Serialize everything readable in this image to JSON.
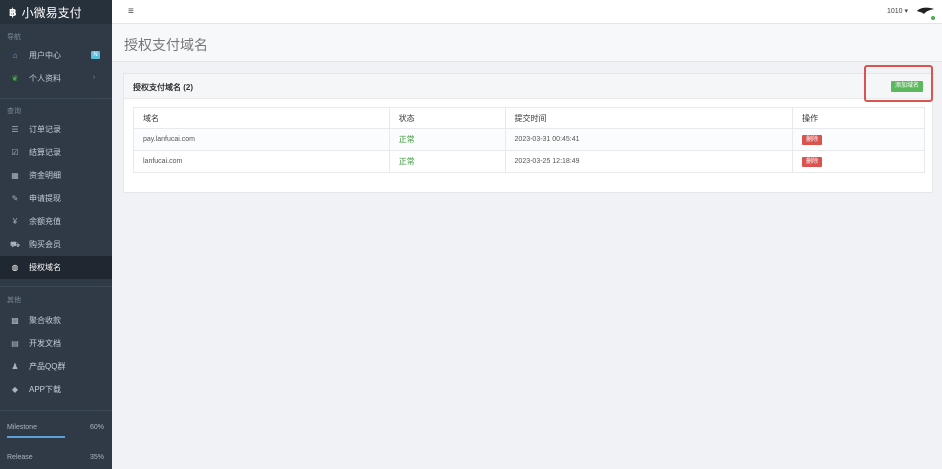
{
  "brand": {
    "logo": "฿",
    "name": "小微易支付"
  },
  "sidebar": {
    "sections": [
      {
        "label": "导航",
        "items": [
          {
            "label": "用户中心",
            "icon": "home-icon",
            "badge": "N"
          },
          {
            "label": "个人资料",
            "icon": "leaf-icon",
            "chevron": "›"
          }
        ]
      },
      {
        "label": "查询",
        "items": [
          {
            "label": "订单记录",
            "icon": "list-icon"
          },
          {
            "label": "结算记录",
            "icon": "checkbox-icon"
          },
          {
            "label": "资金明细",
            "icon": "calendar-icon"
          },
          {
            "label": "申请提现",
            "icon": "edit-icon"
          },
          {
            "label": "余额充值",
            "icon": "yen-icon"
          },
          {
            "label": "购买会员",
            "icon": "cart-icon"
          },
          {
            "label": "授权域名",
            "icon": "globe-icon",
            "active": true
          }
        ]
      },
      {
        "label": "其他",
        "items": [
          {
            "label": "聚合收款",
            "icon": "qrcode-icon"
          },
          {
            "label": "开发文档",
            "icon": "book-icon"
          },
          {
            "label": "产品QQ群",
            "icon": "qq-icon"
          },
          {
            "label": "APP下载",
            "icon": "android-icon"
          }
        ]
      }
    ],
    "progress": [
      {
        "label": "Milestone",
        "percent": "60%",
        "value": 0.6
      },
      {
        "label": "Release",
        "percent": "35%",
        "value": 0.35
      }
    ]
  },
  "topbar": {
    "toggle_icon": "≡",
    "user": "1010 ▾"
  },
  "page": {
    "title": "授权支付域名"
  },
  "panel": {
    "title": "授权支付域名 (2)",
    "add_button": "添加域名",
    "columns": [
      "域名",
      "状态",
      "提交时间",
      "操作"
    ],
    "rows": [
      {
        "domain": "pay.lanfucai.com",
        "status": "正常",
        "time": "2023-03-31 00:45:41",
        "action": "删除"
      },
      {
        "domain": "lanfucai.com",
        "status": "正常",
        "time": "2023-03-25 12:18:49",
        "action": "删除"
      }
    ]
  },
  "colors": {
    "sidebar": "#2f3a46",
    "accent_green": "#5cb85c",
    "danger": "#d9534f",
    "highlight": "#d9534f"
  }
}
